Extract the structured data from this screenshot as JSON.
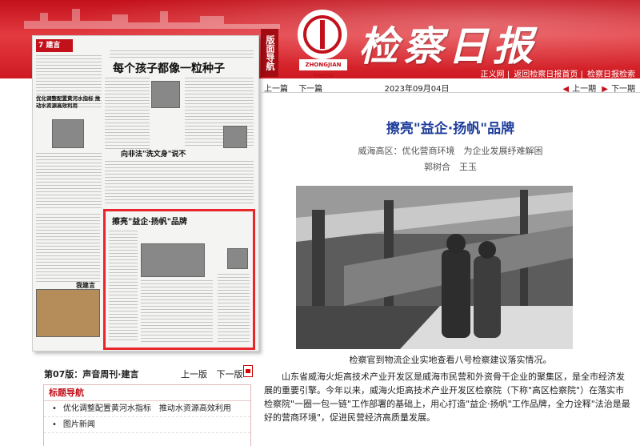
{
  "header": {
    "masthead": "检察日报",
    "logo_tag": "ZHONGJIAN PRESS",
    "guide_tag": "版面导航",
    "links": [
      "正义网",
      "返回检察日报首页",
      "检察日报检索"
    ]
  },
  "thumbnail": {
    "section": "7 建言",
    "headline_top": "每个孩子都像一粒种子",
    "headline_left": "优化调整配置黄河水指标 推动水资源高效利用",
    "headline_mid": "向非法\"洗文身\"说不",
    "headline_box": "擦亮\"益企·扬帆\"品牌",
    "corner_label": "我建言"
  },
  "left_nav": {
    "page_label": "第07版：声音周刊·建言",
    "prev": "上一版",
    "next": "下一版",
    "nav_title": "标题导航",
    "items": [
      "优化调整配置黄河水指标　推动水资源高效利用",
      "图片新闻"
    ]
  },
  "topbar": {
    "prev_article": "上一篇",
    "next_article": "下一篇",
    "date": "2023年09月04日",
    "prev_issue": "上一期",
    "next_issue": "下一期"
  },
  "article": {
    "title": "擦亮\"益企·扬帆\"品牌",
    "subtitle": "威海高区：优化营商环境　为企业发展纾难解困",
    "authors": "郭树合　王玉",
    "caption": "检察官到物流企业实地查看八号检察建议落实情况。",
    "body": "山东省威海火炬高技术产业开发区是威海市民营和外资骨干企业的聚集区，是全市经济发展的重要引擎。今年以来，威海火炬高技术产业开发区检察院（下称\"高区检察院\"）在落实市检察院\"一圈一包一链\"工作部署的基础上，用心打造\"益企·扬帆\"工作品牌，全力诠释\"法治是最好的营商环境\"，促进民营经济高质量发展。"
  },
  "colors": {
    "brand_red": "#c3111b",
    "title_blue": "#1f3e9a",
    "highlight": "#e8262c"
  }
}
